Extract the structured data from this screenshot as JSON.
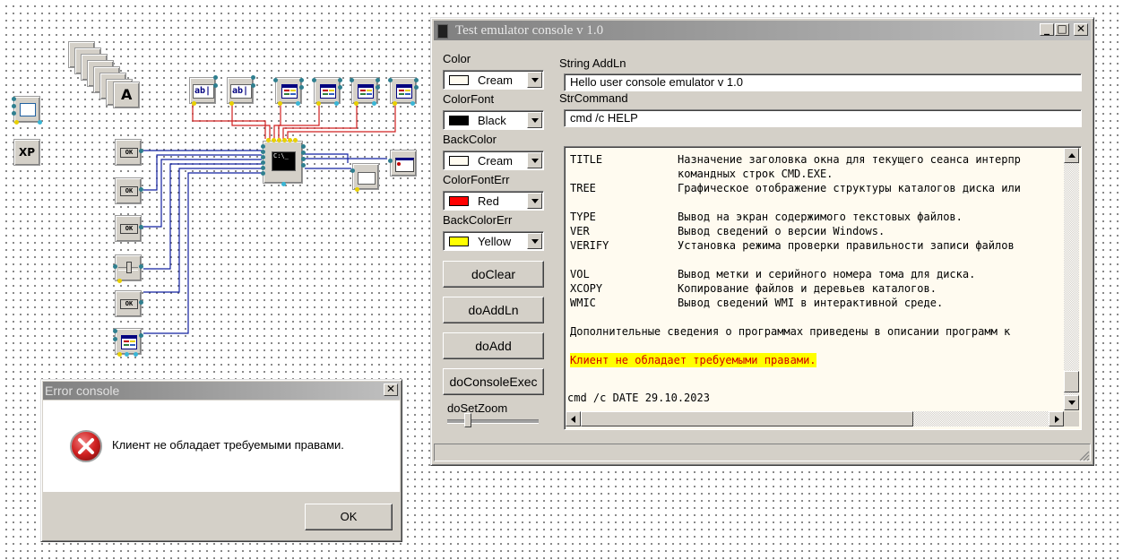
{
  "emulator_window": {
    "title": "Test emulator console v 1.0",
    "controls": {
      "minimize": "_",
      "maximize": "□",
      "close": "✕"
    },
    "color": {
      "label": "Color",
      "value": "Cream",
      "swatch": "#fffbf0"
    },
    "color_font": {
      "label": "ColorFont",
      "value": "Black",
      "swatch": "#000000"
    },
    "back_color": {
      "label": "BackColor",
      "value": "Cream",
      "swatch": "#fffbf0"
    },
    "color_font_err": {
      "label": "ColorFontErr",
      "value": "Red",
      "swatch": "#ff0000"
    },
    "back_color_err": {
      "label": "BackColorErr",
      "value": "Yellow",
      "swatch": "#ffff00"
    },
    "buttons": {
      "do_clear": "doClear",
      "do_add_ln": "doAddLn",
      "do_add": "doAdd",
      "do_console_exec": "doConsoleExec"
    },
    "zoom": {
      "label": "doSetZoom"
    },
    "string_addln": {
      "label": "String AddLn",
      "value": "Hello user console emulator v 1.0"
    },
    "str_command": {
      "label": "StrCommand",
      "value": "cmd /c HELP"
    },
    "console": {
      "lines": [
        {
          "cmd": "TITLE",
          "desc": "Назначение заголовка окна для текущего сеанса интерпр"
        },
        {
          "cmd": "",
          "desc": "командных строк CMD.EXE."
        },
        {
          "cmd": "TREE",
          "desc": "Графическое отображение структуры каталогов диска или"
        },
        {
          "cmd": "",
          "desc": ""
        },
        {
          "cmd": "TYPE",
          "desc": "Вывод на экран содержимого текстовых файлов."
        },
        {
          "cmd": "VER",
          "desc": "Вывод сведений о версии Windows."
        },
        {
          "cmd": "VERIFY",
          "desc": "Установка режима проверки правильности записи файлов"
        },
        {
          "cmd": "",
          "desc": ""
        },
        {
          "cmd": "VOL",
          "desc": "Вывод метки и серийного номера тома для диска."
        },
        {
          "cmd": "XCOPY",
          "desc": "Копирование файлов и деревьев каталогов."
        },
        {
          "cmd": "WMIC",
          "desc": "Вывод сведений WMI в интерактивной среде."
        }
      ],
      "more_info": "Дополнительные сведения о программах приведены в описании программ к",
      "error_line": "Клиент не обладает требуемыми правами.",
      "command_line": "cmd /c DATE 29.10.2023"
    }
  },
  "error_dialog": {
    "title": "Error console",
    "close": "✕",
    "message": "Клиент не обладает требуемыми правами.",
    "ok_label": "OK"
  },
  "canvas": {
    "ok_label": "OK",
    "text_a": "A",
    "xp_label": "XP",
    "ab_label": "ab|",
    "console_glyph": "C:\\_"
  }
}
